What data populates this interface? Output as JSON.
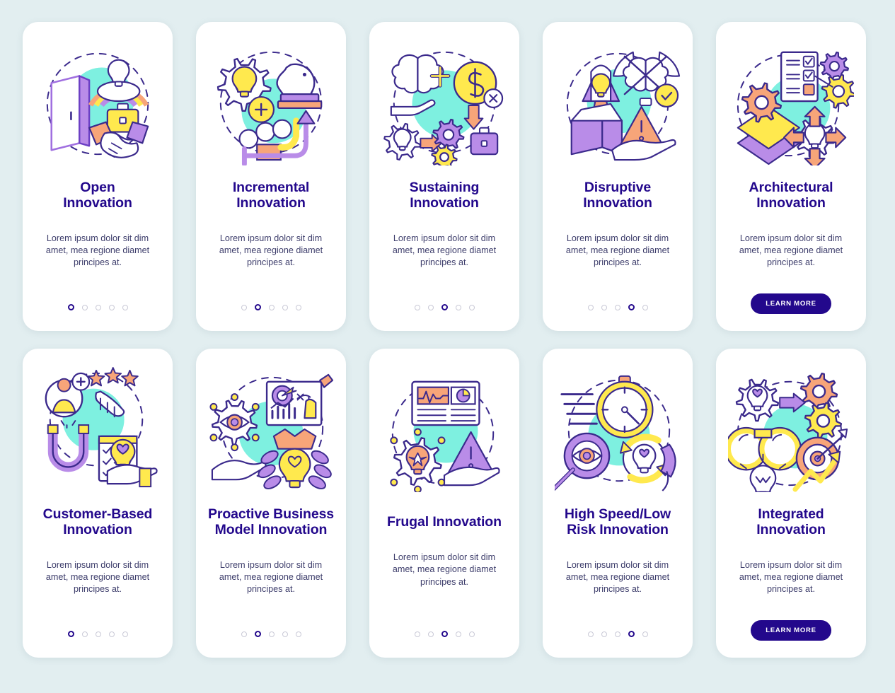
{
  "theme": {
    "page_background": "#e2eef0",
    "card_background": "#ffffff",
    "title_color": "#23088c",
    "body_text_color": "#3d3d6b",
    "accent_button": "#23088c",
    "dot_inactive": "#c9c9d6",
    "illustration_blob": "#7ef0e0",
    "palette_purple": "#b98ce8",
    "palette_orange": "#f7a579",
    "palette_yellow": "#ffe94e",
    "palette_outline": "#3b2a8c"
  },
  "shared": {
    "description": "Lorem ipsum dolor sit dim amet, mea regione diamet principes at.",
    "cta_label": "LEARN MORE",
    "dot_count": 5
  },
  "cards": [
    {
      "id": "open-innovation",
      "title_lines": [
        "Open",
        "Innovation"
      ],
      "description": "Lorem ipsum dolor sit dim amet, mea regione diamet principes at.",
      "active_dot": 1,
      "dot_count": 5,
      "footer": "dots",
      "illustration": "door-handshake-briefcase-bulb-icon"
    },
    {
      "id": "incremental-innovation",
      "title_lines": [
        "Incremental",
        "Innovation"
      ],
      "description": "Lorem ipsum dolor sit dim amet, mea regione diamet principes at.",
      "active_dot": 2,
      "dot_count": 5,
      "footer": "dots",
      "illustration": "gear-bulb-chess-knight-growth-icon"
    },
    {
      "id": "sustaining-innovation",
      "title_lines": [
        "Sustaining",
        "Innovation"
      ],
      "description": "Lorem ipsum dolor sit dim amet, mea regione diamet principes at.",
      "active_dot": 3,
      "dot_count": 5,
      "footer": "dots",
      "illustration": "brain-dollar-gears-briefcase-icon"
    },
    {
      "id": "disruptive-innovation",
      "title_lines": [
        "Disruptive",
        "Innovation"
      ],
      "description": "Lorem ipsum dolor sit dim amet, mea regione diamet principes at.",
      "active_dot": 4,
      "dot_count": 5,
      "footer": "dots",
      "illustration": "rocket-box-brain-warning-icon"
    },
    {
      "id": "architectural-innovation",
      "title_lines": [
        "Architectural",
        "Innovation"
      ],
      "description": "Lorem ipsum dolor sit dim amet, mea regione diamet principes at.",
      "active_dot": 0,
      "dot_count": 0,
      "footer": "button",
      "cta_label": "LEARN MORE",
      "illustration": "checklist-gears-layers-bulb-arrows-icon"
    },
    {
      "id": "customer-based-innovation",
      "title_lines": [
        "Customer-Based",
        "Innovation"
      ],
      "description": "Lorem ipsum dolor sit dim amet, mea regione diamet principes at.",
      "active_dot": 1,
      "dot_count": 5,
      "footer": "dots",
      "illustration": "magnet-user-stars-checklist-icon"
    },
    {
      "id": "proactive-business-model-innovation",
      "title_lines": [
        "Proactive Business",
        "Model Innovation"
      ],
      "description": "Lorem ipsum dolor sit dim amet, mea regione diamet principes at.",
      "active_dot": 2,
      "dot_count": 5,
      "footer": "dots",
      "illustration": "eye-gear-whiteboard-crown-bulb-icon"
    },
    {
      "id": "frugal-innovation",
      "title_lines": [
        "Frugal Innovation"
      ],
      "description": "Lorem ipsum dolor sit dim amet, mea regione diamet principes at.",
      "active_dot": 3,
      "dot_count": 5,
      "footer": "dots",
      "illustration": "dashboard-gear-bulb-warning-hand-icon"
    },
    {
      "id": "high-speed-low-risk-innovation",
      "title_lines": [
        "High Speed/Low",
        "Risk Innovation"
      ],
      "description": "Lorem ipsum dolor sit dim amet, mea regione diamet principes at.",
      "active_dot": 4,
      "dot_count": 5,
      "footer": "dots",
      "illustration": "stopwatch-magnifier-bulb-cycle-icon"
    },
    {
      "id": "integrated-innovation",
      "title_lines": [
        "Integrated",
        "Innovation"
      ],
      "description": "Lorem ipsum dolor sit dim amet, mea regione diamet principes at.",
      "active_dot": 0,
      "dot_count": 0,
      "footer": "button",
      "cta_label": "LEARN MORE",
      "illustration": "binoculars-gears-target-growth-bulb-icon"
    }
  ]
}
